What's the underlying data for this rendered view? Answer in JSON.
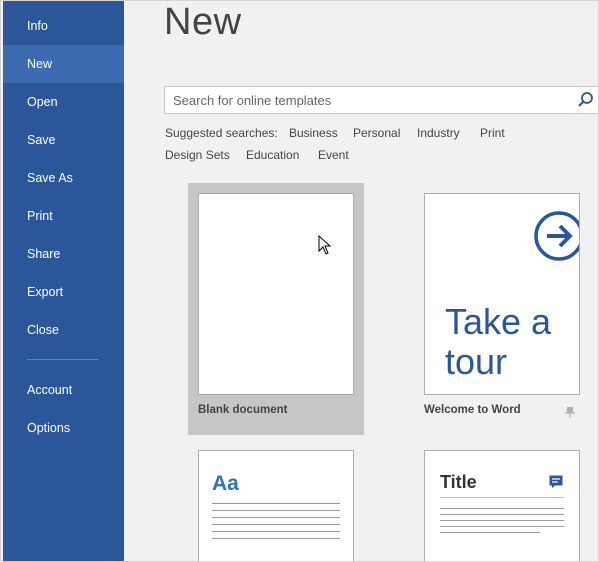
{
  "sidebar": {
    "items": [
      {
        "label": "Info"
      },
      {
        "label": "New",
        "active": true
      },
      {
        "label": "Open"
      },
      {
        "label": "Save"
      },
      {
        "label": "Save As"
      },
      {
        "label": "Print"
      },
      {
        "label": "Share"
      },
      {
        "label": "Export"
      },
      {
        "label": "Close"
      },
      {
        "label": "Account"
      },
      {
        "label": "Options"
      }
    ],
    "bg_color": "#2b579a",
    "active_color": "#3c6bb2"
  },
  "main": {
    "title": "New",
    "search": {
      "placeholder": "Search for online templates",
      "value": "",
      "icon": "search-icon"
    },
    "suggested": {
      "label": "Suggested searches:",
      "links": [
        "Business",
        "Personal",
        "Industry",
        "Print",
        "Design Sets",
        "Education",
        "Event"
      ]
    },
    "templates": {
      "blank": {
        "label": "Blank document"
      },
      "tour": {
        "label": "Welcome to Word",
        "thumb_text": "Take a\ntour",
        "icon": "arrow-right-circle-icon",
        "pin_icon": "pin-icon"
      },
      "aa": {
        "thumb_text": "Aa"
      },
      "title": {
        "thumb_text": "Title",
        "icon": "comment-icon"
      }
    }
  },
  "accent_color": "#2b579a"
}
